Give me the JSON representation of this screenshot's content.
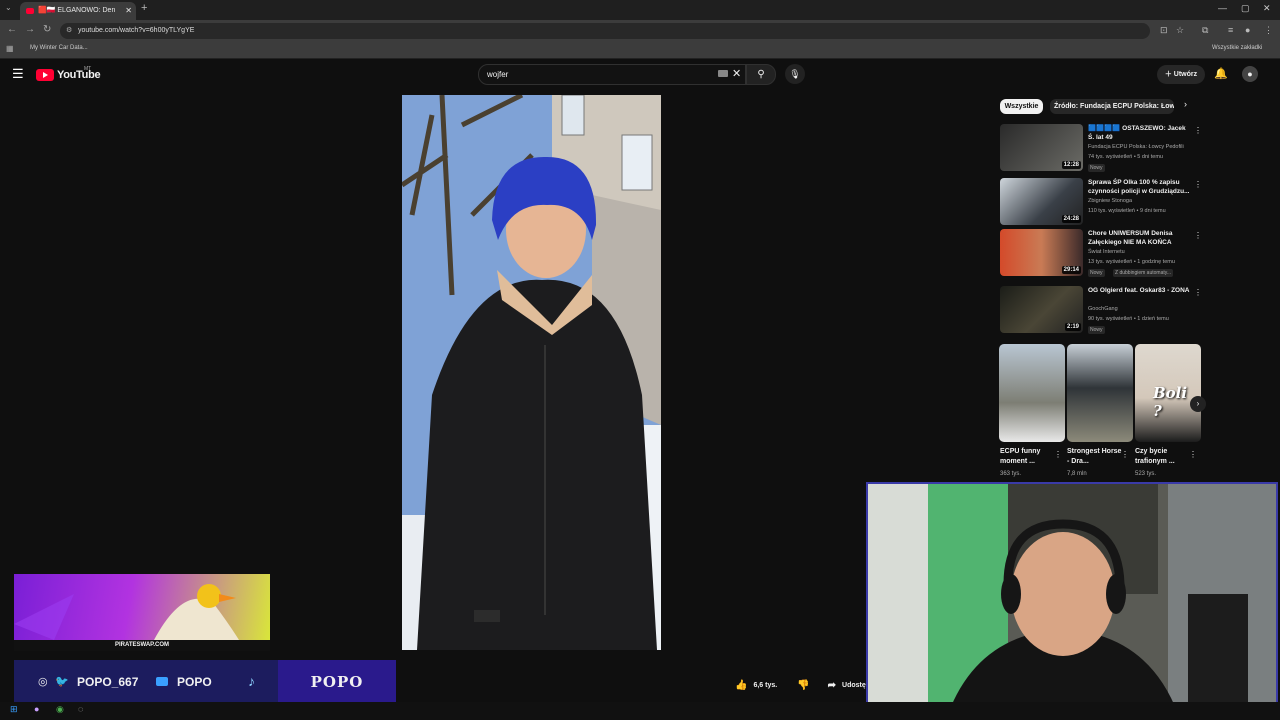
{
  "browser": {
    "tab_title": "🟥🇵🇱 ELGANOWO: Den",
    "url": "youtube.com/watch?v=6h00yTLYgYE",
    "bookmark": "My Winter Car Data...",
    "all_bookmarks": "Wszystkie zakładki"
  },
  "youtube": {
    "logo": "YouTube",
    "country_code": "MT",
    "search_value": "wojfer",
    "create_label": "Utwórz"
  },
  "video": {
    "likes": "6,6 tys.",
    "share_label": "Udostępnij"
  },
  "chips": [
    "Wszystkie",
    "Źródło: Fundacja ECPU Polska: Łowcy"
  ],
  "related": [
    {
      "title": "🟦🟦🟦🟦 OSTASZEWO: Jacek Ś. lat 49",
      "channel": "Fundacja ECPU Polska: Łowcy Pedofili",
      "meta": "74 tys. wyświetleń • 5 dni temu",
      "badge": "Nowy",
      "duration": "12:28"
    },
    {
      "title": "Sprawa ŚP Olka 100 % zapisu czynności policji w Grudziądzu...",
      "channel": "Zbigniew Stonoga",
      "meta": "110 tys. wyświetleń • 9 dni temu",
      "badge": "",
      "duration": "24:28"
    },
    {
      "title": "Chore UNIWERSUM Denisa Załęckiego NIE MA KOŃCA",
      "channel": "Świat Internetu",
      "meta": "13 tys. wyświetleń • 1 godzinę temu",
      "badge": "Nowy",
      "badge2": "Z dubbingiem automaty...",
      "duration": "29:14"
    },
    {
      "title": "OG Olgierd feat. Oskar83 - ZONA",
      "channel": "GoochGang",
      "meta": "90 tys. wyświetleń • 1 dzień temu",
      "badge": "Nowy",
      "duration": "2:19"
    }
  ],
  "shorts": [
    {
      "title": "ECPU funny moment ...",
      "views": "363 tys."
    },
    {
      "title": "Strongest Horse - Dra...",
      "views": "7,8 mln"
    },
    {
      "title": "Czy bycie trafionym ...",
      "views": "523 tys.",
      "overlay": "Boli ?"
    }
  ],
  "overlay": {
    "banner_text": "PIRATESWAP.COM",
    "handle": "POPO_667",
    "youtube_name": "POPO",
    "logo_text": "POPO"
  }
}
